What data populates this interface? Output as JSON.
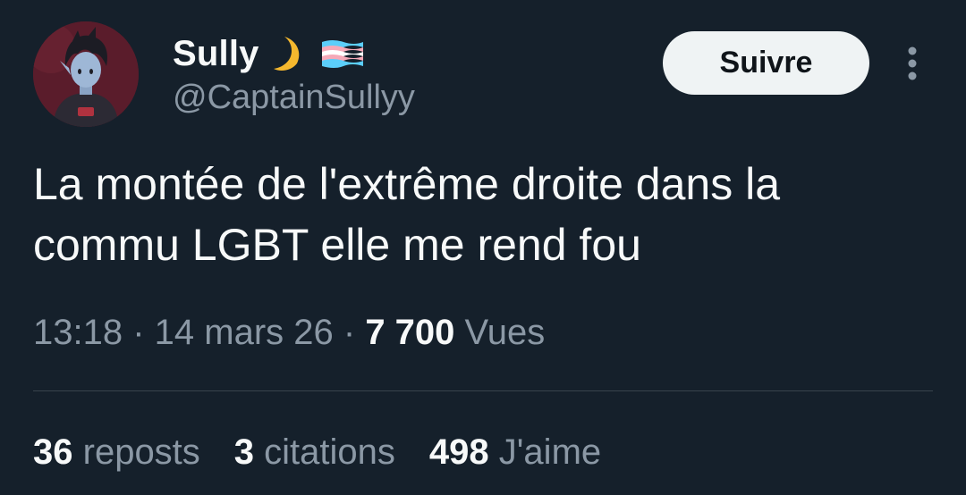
{
  "user": {
    "display_name": "Sully",
    "handle": "@CaptainSullyy",
    "emoji_icons": [
      "crescent-moon-icon",
      "transgender-flag-icon"
    ]
  },
  "follow_button": {
    "label": "Suivre"
  },
  "tweet": {
    "text": "La montée de l'extrême droite dans la\ncommu LGBT elle me rend fou"
  },
  "meta": {
    "time": "13:18",
    "separator": " · ",
    "date": "14 mars 26",
    "views_count": "7 700",
    "views_label": "Vues"
  },
  "stats": {
    "reposts_count": "36",
    "reposts_label": "reposts",
    "quotes_count": "3",
    "quotes_label": "citations",
    "likes_count": "498",
    "likes_label": "J'aime"
  },
  "colors": {
    "background": "#15202b",
    "text_primary": "#f7f9f9",
    "text_secondary": "#8b98a5",
    "divider": "#38444d",
    "button_bg": "#eff3f4",
    "moon": "#f5b82e",
    "flag_blue": "#5bcefa",
    "flag_pink": "#f5a9b8",
    "flag_white": "#ffffff"
  }
}
